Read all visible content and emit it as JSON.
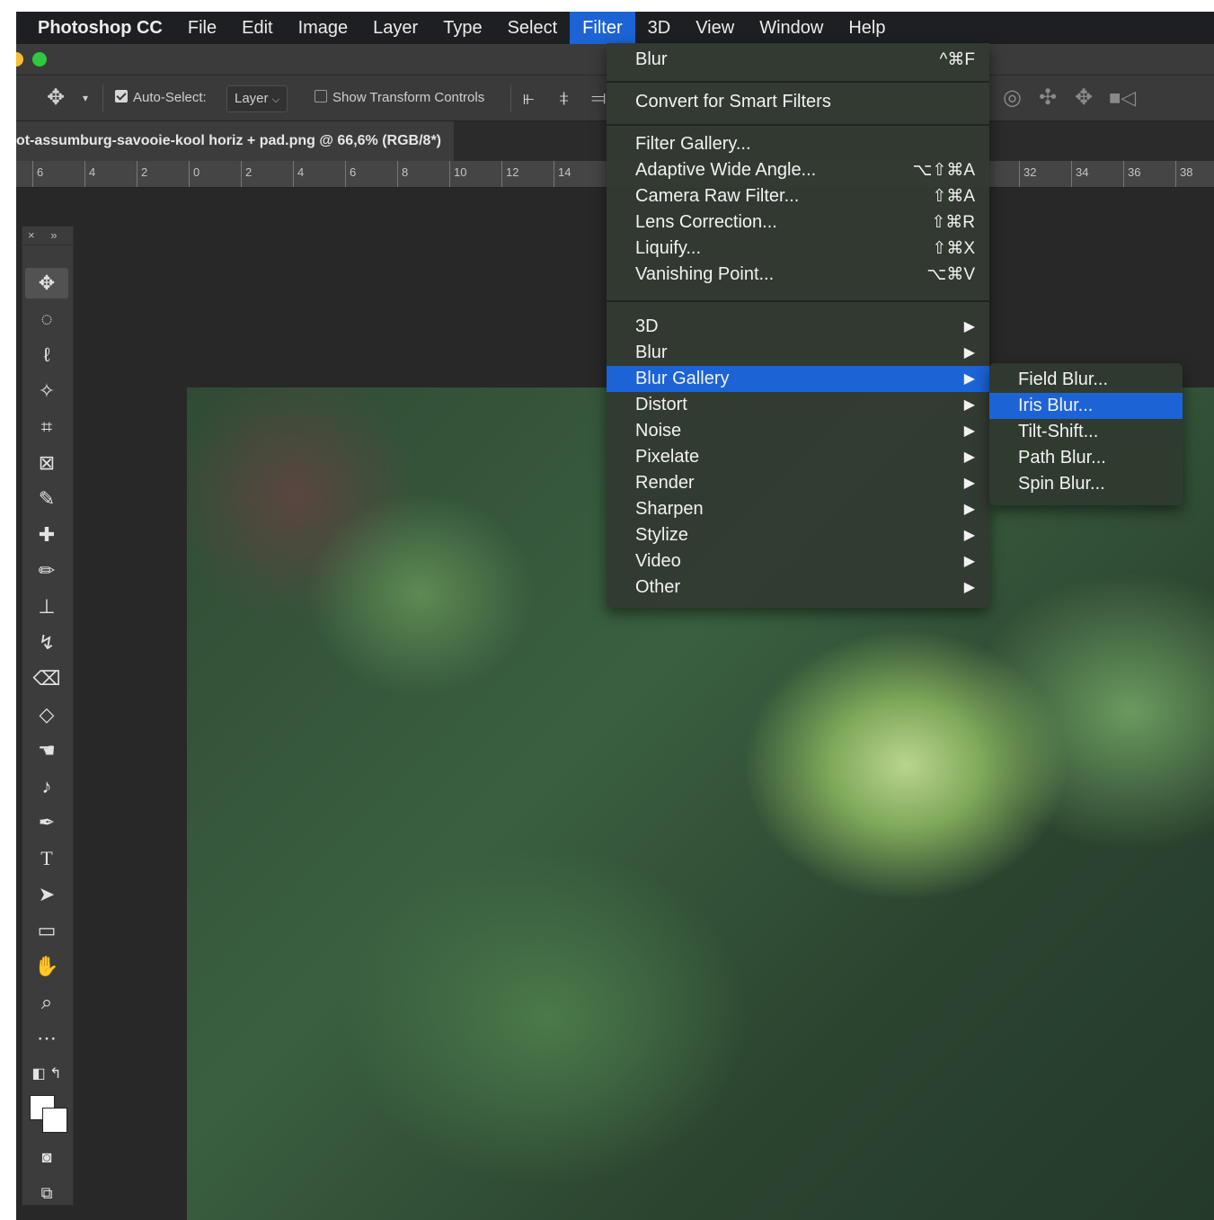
{
  "menubar": {
    "app_name": "Photoshop CC",
    "items": [
      "File",
      "Edit",
      "Image",
      "Layer",
      "Type",
      "Select",
      "Filter",
      "3D",
      "View",
      "Window",
      "Help"
    ],
    "active": "Filter"
  },
  "options": {
    "auto_select_label": "Auto-Select:",
    "auto_select_checked": true,
    "layer_dropdown": "Layer",
    "show_transform_label": "Show Transform Controls",
    "show_transform_checked": false
  },
  "document": {
    "tab_title": "ot-assumburg-savooie-kool horiz + pad.png @ 66,6% (RGB/8*)"
  },
  "ruler": {
    "left_ticks": [
      "6",
      "4",
      "2",
      "0",
      "2",
      "4",
      "6",
      "8",
      "10",
      "12",
      "14"
    ],
    "right_ticks": [
      "32",
      "34",
      "36",
      "38"
    ]
  },
  "filter_menu": {
    "last_filter": {
      "label": "Blur",
      "shortcut": "^⌘F"
    },
    "convert_smart": "Convert for Smart Filters",
    "group2": [
      {
        "label": "Filter Gallery...",
        "shortcut": ""
      },
      {
        "label": "Adaptive Wide Angle...",
        "shortcut": "⌥⇧⌘A"
      },
      {
        "label": "Camera Raw Filter...",
        "shortcut": "⇧⌘A"
      },
      {
        "label": "Lens Correction...",
        "shortcut": "⇧⌘R"
      },
      {
        "label": "Liquify...",
        "shortcut": "⇧⌘X"
      },
      {
        "label": "Vanishing Point...",
        "shortcut": "⌥⌘V"
      }
    ],
    "submenus": [
      "3D",
      "Blur",
      "Blur Gallery",
      "Distort",
      "Noise",
      "Pixelate",
      "Render",
      "Sharpen",
      "Stylize",
      "Video",
      "Other"
    ],
    "highlighted": "Blur Gallery",
    "arrow_glyph": "▶"
  },
  "blur_gallery_submenu": {
    "items": [
      "Field Blur...",
      "Iris Blur...",
      "Tilt-Shift...",
      "Path Blur...",
      "Spin Blur..."
    ],
    "highlighted": "Iris Blur..."
  },
  "toolbox": {
    "header_close": "×",
    "header_expand": "»",
    "tools": [
      "move-tool-icon",
      "marquee-tool-icon",
      "lasso-tool-icon",
      "magic-wand-icon",
      "crop-tool-icon",
      "frame-tool-icon",
      "eyedropper-icon",
      "healing-brush-icon",
      "brush-tool-icon",
      "clone-stamp-icon",
      "history-brush-icon",
      "eraser-icon",
      "paint-bucket-icon",
      "smudge-icon",
      "dodge-icon",
      "pen-tool-icon",
      "type-tool-icon",
      "path-selection-icon",
      "rectangle-tool-icon",
      "hand-tool-icon",
      "zoom-tool-icon",
      "more-tools-icon"
    ]
  },
  "colors": {
    "highlight": "#1c63d6",
    "menubar_bg": "#1e1f22",
    "traffic_yellow": "#f5bf2f",
    "traffic_green": "#2fc840"
  }
}
